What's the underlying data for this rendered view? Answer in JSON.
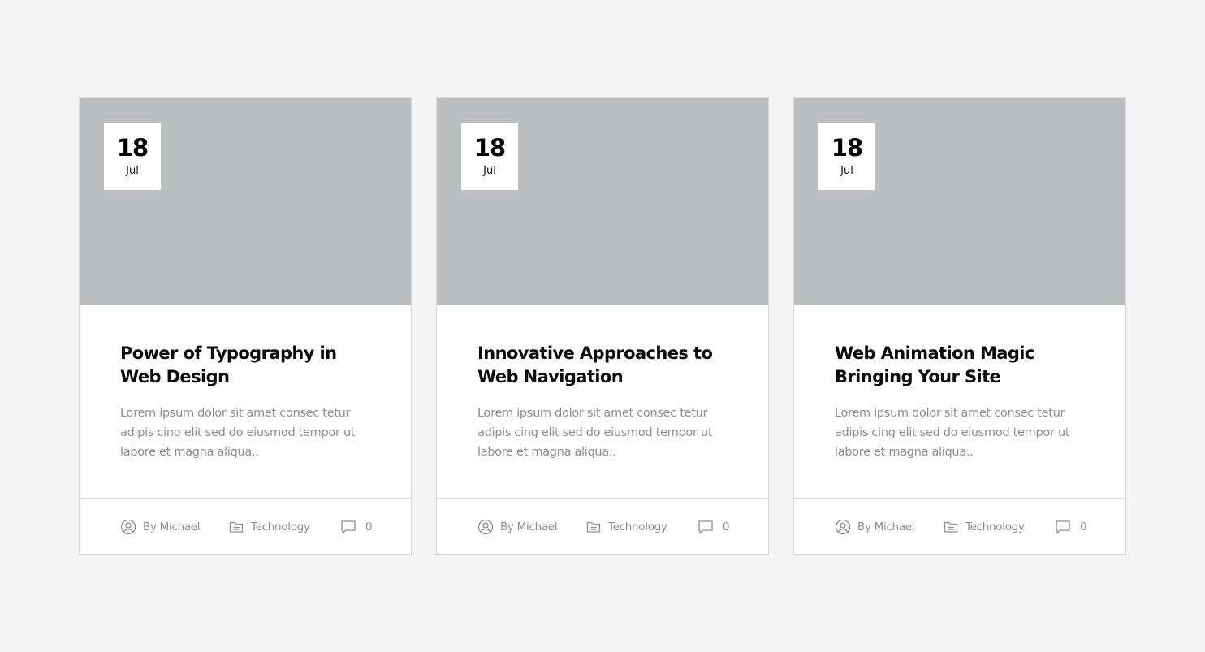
{
  "colors": {
    "page_background": "#f4f4f4",
    "thumbnail_placeholder": "#bcbdbf",
    "card_background": "#ffffff",
    "title_text": "#0b0b0b",
    "muted_text": "#8d8d8d"
  },
  "icons": {
    "author": "user-circle-icon",
    "category": "folder-icon",
    "comments": "comment-icon"
  },
  "posts": [
    {
      "date_day": "18",
      "date_month": "Jul",
      "title": "Power of Typography in Web Design",
      "excerpt": "Lorem ipsum dolor sit amet consec tetur adipis cing elit sed do eiusmod tempor ut labore et magna aliqua..",
      "author": "By Michael",
      "category": "Technology",
      "comments": "0"
    },
    {
      "date_day": "18",
      "date_month": "Jul",
      "title": "Innovative Approaches to Web Navigation",
      "excerpt": "Lorem ipsum dolor sit amet consec tetur adipis cing elit sed do eiusmod tempor ut labore et magna aliqua..",
      "author": "By Michael",
      "category": "Technology",
      "comments": "0"
    },
    {
      "date_day": "18",
      "date_month": "Jul",
      "title": "Web Animation Magic Bringing Your Site",
      "excerpt": "Lorem ipsum dolor sit amet consec tetur adipis cing elit sed do eiusmod tempor ut labore et magna aliqua..",
      "author": "By Michael",
      "category": "Technology",
      "comments": "0"
    }
  ]
}
